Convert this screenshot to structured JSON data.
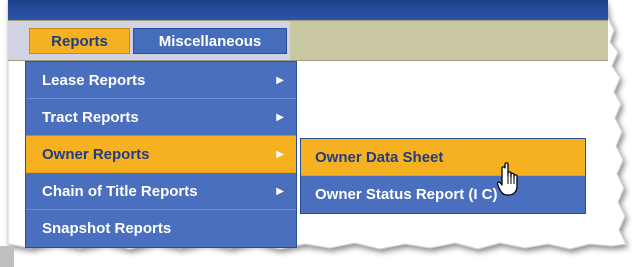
{
  "menubar": {
    "items": [
      {
        "label": "Reports",
        "state": "active"
      },
      {
        "label": "Miscellaneous",
        "state": "normal"
      }
    ]
  },
  "reports_menu": {
    "items": [
      {
        "label": "Lease Reports",
        "has_submenu": true
      },
      {
        "label": "Tract Reports",
        "has_submenu": true
      },
      {
        "label": "Owner Reports",
        "has_submenu": true,
        "state": "highlighted"
      },
      {
        "label": "Chain of Title Reports",
        "has_submenu": true
      },
      {
        "label": "Snapshot Reports",
        "has_submenu": false
      }
    ],
    "submenu_arrow_icon": "triangle-right"
  },
  "owner_submenu": {
    "items": [
      {
        "label": "Owner Data Sheet",
        "state": "hovered"
      },
      {
        "label": "Owner Status Report (I C)",
        "state": "normal"
      }
    ]
  },
  "cursor": {
    "icon": "hand-pointer-icon"
  },
  "colors": {
    "menu_blue": "#4a6fbe",
    "highlight_gold": "#f5b120",
    "highlight_text": "#1f3d86",
    "menubar_tan": "#c9c7a1",
    "top_strip": "#2b55a8"
  }
}
